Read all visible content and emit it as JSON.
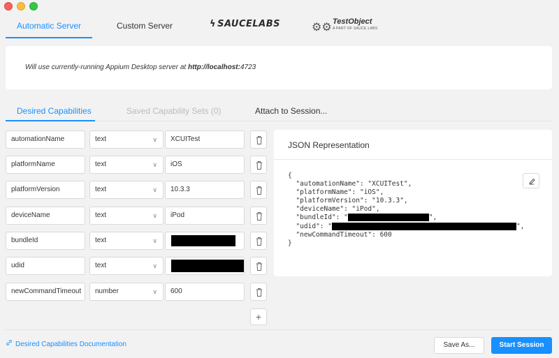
{
  "server_tabs": {
    "automatic": "Automatic Server",
    "custom": "Custom Server",
    "saucelabs": "SAUCELABS",
    "testobject": "TestObject",
    "testobject_sub": "A PART OF SAUCE LABS"
  },
  "info": {
    "prefix": "Will use currently-running Appium Desktop server at ",
    "url": "http://localhost:",
    "port": "4723"
  },
  "cap_tabs": {
    "desired": "Desired Capabilities",
    "saved": "Saved Capability Sets (0)",
    "attach": "Attach to Session..."
  },
  "capabilities": [
    {
      "name": "automationName",
      "type": "text",
      "value": "XCUITest"
    },
    {
      "name": "platformName",
      "type": "text",
      "value": "iOS"
    },
    {
      "name": "platformVersion",
      "type": "text",
      "value": "10.3.3"
    },
    {
      "name": "deviceName",
      "type": "text",
      "value": "iPod"
    },
    {
      "name": "bundleId",
      "type": "text",
      "value": ""
    },
    {
      "name": "udid",
      "type": "text",
      "value": ""
    },
    {
      "name": "newCommandTimeout",
      "type": "number",
      "value": "600"
    }
  ],
  "json_panel": {
    "title": "JSON Representation",
    "open": "{",
    "lines": [
      {
        "key": "automationName",
        "value": "XCUITest"
      },
      {
        "key": "platformName",
        "value": "iOS"
      },
      {
        "key": "platformVersion",
        "value": "10.3.3"
      },
      {
        "key": "deviceName",
        "value": "iPod"
      },
      {
        "key": "bundleId",
        "value": ""
      },
      {
        "key": "udid",
        "value": ""
      }
    ],
    "last_key": "newCommandTimeout",
    "last_value": "600",
    "close": "}"
  },
  "footer": {
    "doc_link": "Desired Capabilities Documentation",
    "save_as": "Save As...",
    "start": "Start Session"
  },
  "colors": {
    "accent": "#1890ff",
    "background": "#f2f2f2"
  }
}
